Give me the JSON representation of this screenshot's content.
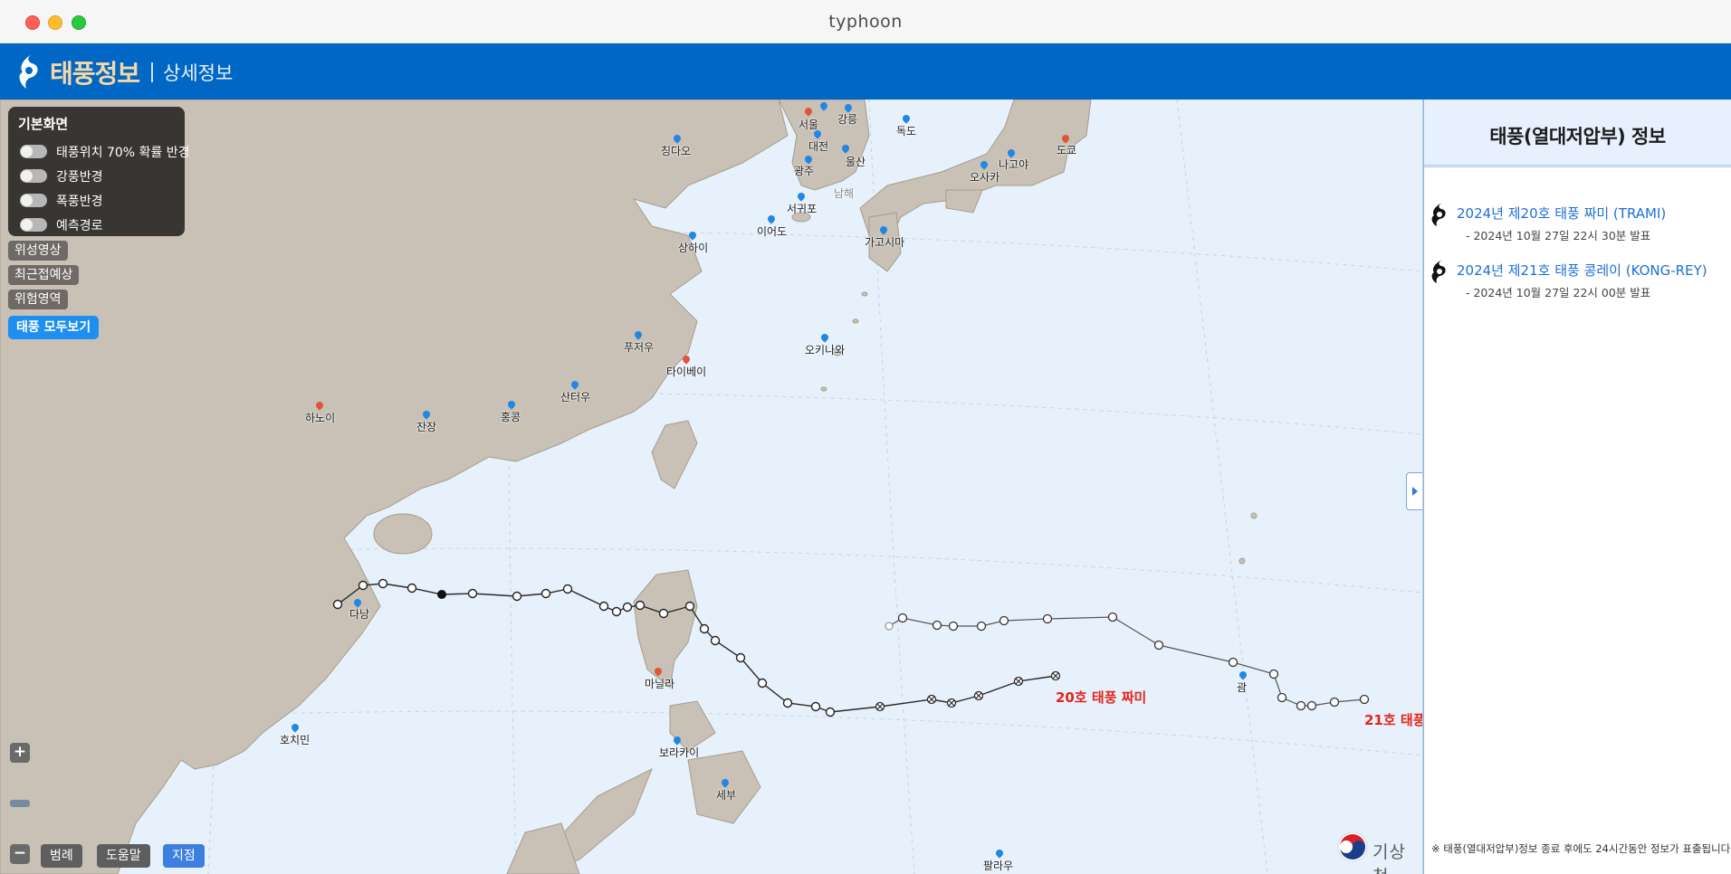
{
  "window": {
    "title": "typhoon"
  },
  "header": {
    "brand": "태풍정보",
    "subtitle": "상세정보"
  },
  "layers": {
    "title": "기본화면",
    "toggles": [
      {
        "label": "태풍위치 70% 확률 반경",
        "on": false
      },
      {
        "label": "강풍반경",
        "on": false
      },
      {
        "label": "폭풍반경",
        "on": false
      },
      {
        "label": "예측경로",
        "on": false
      }
    ],
    "buttons": [
      "위성영상",
      "최근접예상",
      "위험영역"
    ],
    "show_all": "태풍 모두보기"
  },
  "map": {
    "cities": {
      "seoul": "서울",
      "gangneung": "강릉",
      "dokdo": "독도",
      "qingdao": "칭다오",
      "daejeon": "대전",
      "gwangju": "광주",
      "ulsan": "울산",
      "seogwipo": "서귀포",
      "ieodo": "이어도",
      "nagoya": "나고야",
      "tokyo": "도쿄",
      "osaka": "오사카",
      "kagoshima": "가고시마",
      "shanghai": "상하이",
      "okinawa": "오키나와",
      "fuzhou": "푸저우",
      "taipei": "타이베이",
      "shantou": "산터우",
      "hongkong": "홍콩",
      "zhanjiang": "잔장",
      "hanoi": "하노이",
      "danang": "다낭",
      "manila": "마닐라",
      "boracay": "보라카이",
      "cebu": "세부",
      "hochiminh": "호치민",
      "guam": "괌",
      "palau": "팔라우",
      "sea_south": "남해"
    },
    "typhoon_labels": {
      "trami": "20호 태풍 짜미",
      "kongrey": "21호 태풍"
    },
    "zoom": {
      "in": "+",
      "out": "−"
    },
    "bottom_buttons": [
      "범례",
      "도움말",
      "지점"
    ],
    "active_bottom": "지점",
    "agency": "기상청"
  },
  "panel": {
    "title": "태풍(열대저압부) 정보",
    "typhoons": [
      {
        "name": "2024년 제20호 태풍 짜미 (TRAMI)",
        "issued": "- 2024년 10월 27일 22시 30분 발표"
      },
      {
        "name": "2024년 제21호 태풍 콩레이 (KONG-REY)",
        "issued": "- 2024년 10월 27일 22시 00분 발표"
      }
    ],
    "footnote": "※ 태풍(열대저압부)정보 종료 후에도 24시간동안 정보가 표출됩니다."
  },
  "colors": {
    "header": "#0068c4",
    "brand": "#f6d7a6",
    "land": "#c9c1b5",
    "sea": "#e7f1fb",
    "track": "#333333",
    "label_red": "#e4231b",
    "accent": "#1f8ef1"
  }
}
